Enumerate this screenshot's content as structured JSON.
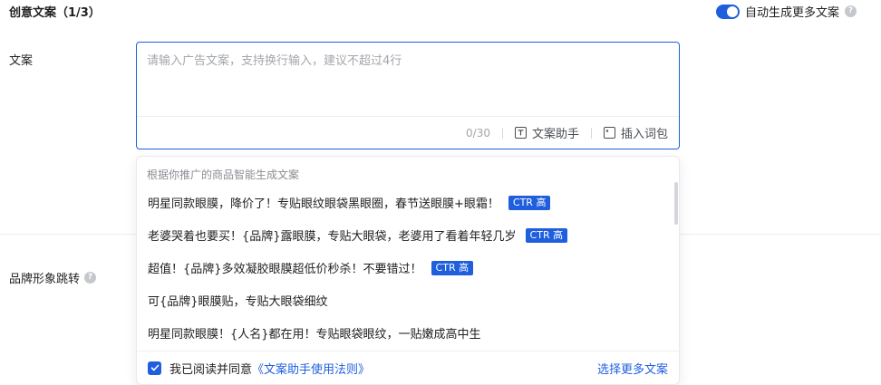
{
  "section": {
    "title": "创意文案（1/3）",
    "auto_generate_label": "自动生成更多文案",
    "auto_generate_on": true
  },
  "copy_field": {
    "label": "文案",
    "placeholder": "请输入广告文案，支持换行输入，建议不超过4行",
    "value": "",
    "counter": "0/30",
    "assistant_label": "文案助手",
    "insert_label": "插入词包"
  },
  "brand_jump": {
    "label": "品牌形象跳转"
  },
  "dropdown": {
    "hint": "根据你推广的商品智能生成文案",
    "suggestions": [
      {
        "text": "明星同款眼膜，降价了！专贴眼纹眼袋黑眼圈，春节送眼膜+眼霜！",
        "badge": "CTR 高"
      },
      {
        "text": "老婆哭着也要买！{品牌}露眼膜，专贴大眼袋，老婆用了看着年轻几岁",
        "badge": "CTR 高"
      },
      {
        "text": "超值！{品牌}多效凝胶眼膜超低价秒杀！不要错过！",
        "badge": "CTR 高"
      },
      {
        "text": "可{品牌}眼膜贴，专贴大眼袋细纹",
        "badge": ""
      },
      {
        "text": "明星同款眼膜！{人名}都在用！专贴眼袋眼纹，一贴嫩成高中生",
        "badge": ""
      }
    ],
    "agree_prefix": "我已阅读并同意",
    "agree_link": "《文案助手使用法则》",
    "agree_checked": true,
    "more_label": "选择更多文案"
  },
  "colors": {
    "accent": "#1f5fde",
    "text": "#1f1f1f",
    "muted": "#8a8d93",
    "border": "#eceef0"
  },
  "icons": {
    "assistant": "text-t-icon",
    "insert": "word-pack-icon",
    "help": "question-circle-icon",
    "check": "check-icon"
  }
}
